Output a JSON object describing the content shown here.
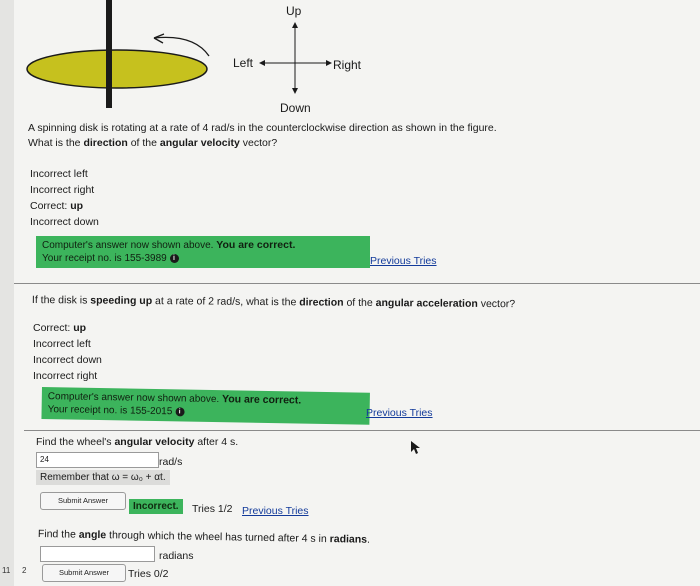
{
  "figure": {
    "label_up": "Up",
    "label_down": "Down",
    "label_left": "Left",
    "label_right": "Right"
  },
  "q1": {
    "question_line1": "A spinning disk is rotating at a rate of 4 rad/s in the counterclockwise direction as shown in the figure.",
    "question_line2_pre": "What is the ",
    "question_line2_b1": "direction",
    "question_line2_mid": " of the ",
    "question_line2_b2": "angular velocity",
    "question_line2_post": " vector?",
    "results": [
      {
        "status": "Incorrect",
        "answer": "left",
        "bold": false
      },
      {
        "status": "Incorrect",
        "answer": "right",
        "bold": false
      },
      {
        "status": "Correct:",
        "answer": "up",
        "bold": true
      },
      {
        "status": "Incorrect",
        "answer": "down",
        "bold": false
      }
    ],
    "feedback_line1": "Computer's answer now shown above.",
    "feedback_strong": "You are correct.",
    "feedback_line2": "Your receipt no. is 155-3989",
    "previous_tries": "Previous Tries"
  },
  "q2": {
    "question_pre": "If the disk is ",
    "question_b1": "speeding up",
    "question_mid": " at a rate of 2 rad/s",
    "question_sup": "2",
    "question_mid2": ", what is the ",
    "question_b2": "direction",
    "question_mid3": " of the ",
    "question_b3": "angular acceleration",
    "question_post": " vector?",
    "results": [
      {
        "status": "Correct:",
        "answer": "up",
        "bold": true
      },
      {
        "status": "Incorrect",
        "answer": "left",
        "bold": false
      },
      {
        "status": "Incorrect",
        "answer": "down",
        "bold": false
      },
      {
        "status": "Incorrect",
        "answer": "right",
        "bold": false
      }
    ],
    "feedback_line1": "Computer's answer now shown above.",
    "feedback_strong": "You are correct.",
    "feedback_line2": "Your receipt no. is 155-2015",
    "previous_tries": "Previous Tries"
  },
  "q3": {
    "question_pre": "Find the wheel's ",
    "question_b1": "angular velocity",
    "question_post": " after 4 s.",
    "input_value": "24",
    "unit": "rad/s",
    "remember": "Remember that ω = ω₀ + αt.",
    "submit_label": "Submit Answer",
    "status_badge": "Incorrect.",
    "tries": "Tries 1/2",
    "previous_tries": "Previous Tries"
  },
  "q4": {
    "question_pre": "Find the ",
    "question_b1": "angle",
    "question_mid": " through which the wheel has turned after 4 s in ",
    "question_b2": "radians",
    "question_post": ".",
    "input_value": "",
    "unit": "radians",
    "submit_label": "Submit Answer",
    "tries": "Tries 0/2"
  },
  "left_margin": {
    "mark1": "11",
    "mark2": "2"
  },
  "colors": {
    "feedback_green": "#3cb45c",
    "link_blue": "#123a9a"
  }
}
